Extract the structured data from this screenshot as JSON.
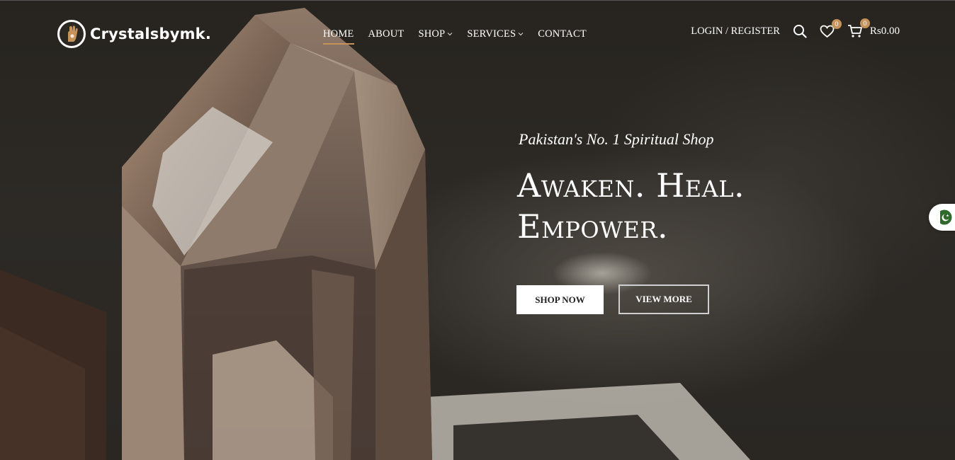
{
  "brand": {
    "name": "Crystalsbymk."
  },
  "nav": {
    "items": [
      {
        "label": "HOME",
        "active": true
      },
      {
        "label": "ABOUT"
      },
      {
        "label": "SHOP",
        "dropdown": true
      },
      {
        "label": "SERVICES",
        "dropdown": true
      },
      {
        "label": "CONTACT"
      }
    ]
  },
  "header": {
    "login_label": "LOGIN / REGISTER",
    "wishlist_count": "0",
    "cart_count": "0",
    "cart_total": "Rs0.00"
  },
  "hero": {
    "tagline": "Pakistan's No. 1 Spiritual Shop",
    "headline_line1": "Awaken. Heal.",
    "headline_line2": "Empower.",
    "shop_now_label": "SHOP NOW",
    "view_more_label": "VIEW MORE"
  },
  "icons": {
    "search": "search-icon",
    "wishlist": "heart-icon",
    "cart": "cart-icon",
    "language": "pakistan-flag-icon"
  },
  "colors": {
    "accent": "#c6935a",
    "background": "#2a2723",
    "text": "#ffffff"
  }
}
